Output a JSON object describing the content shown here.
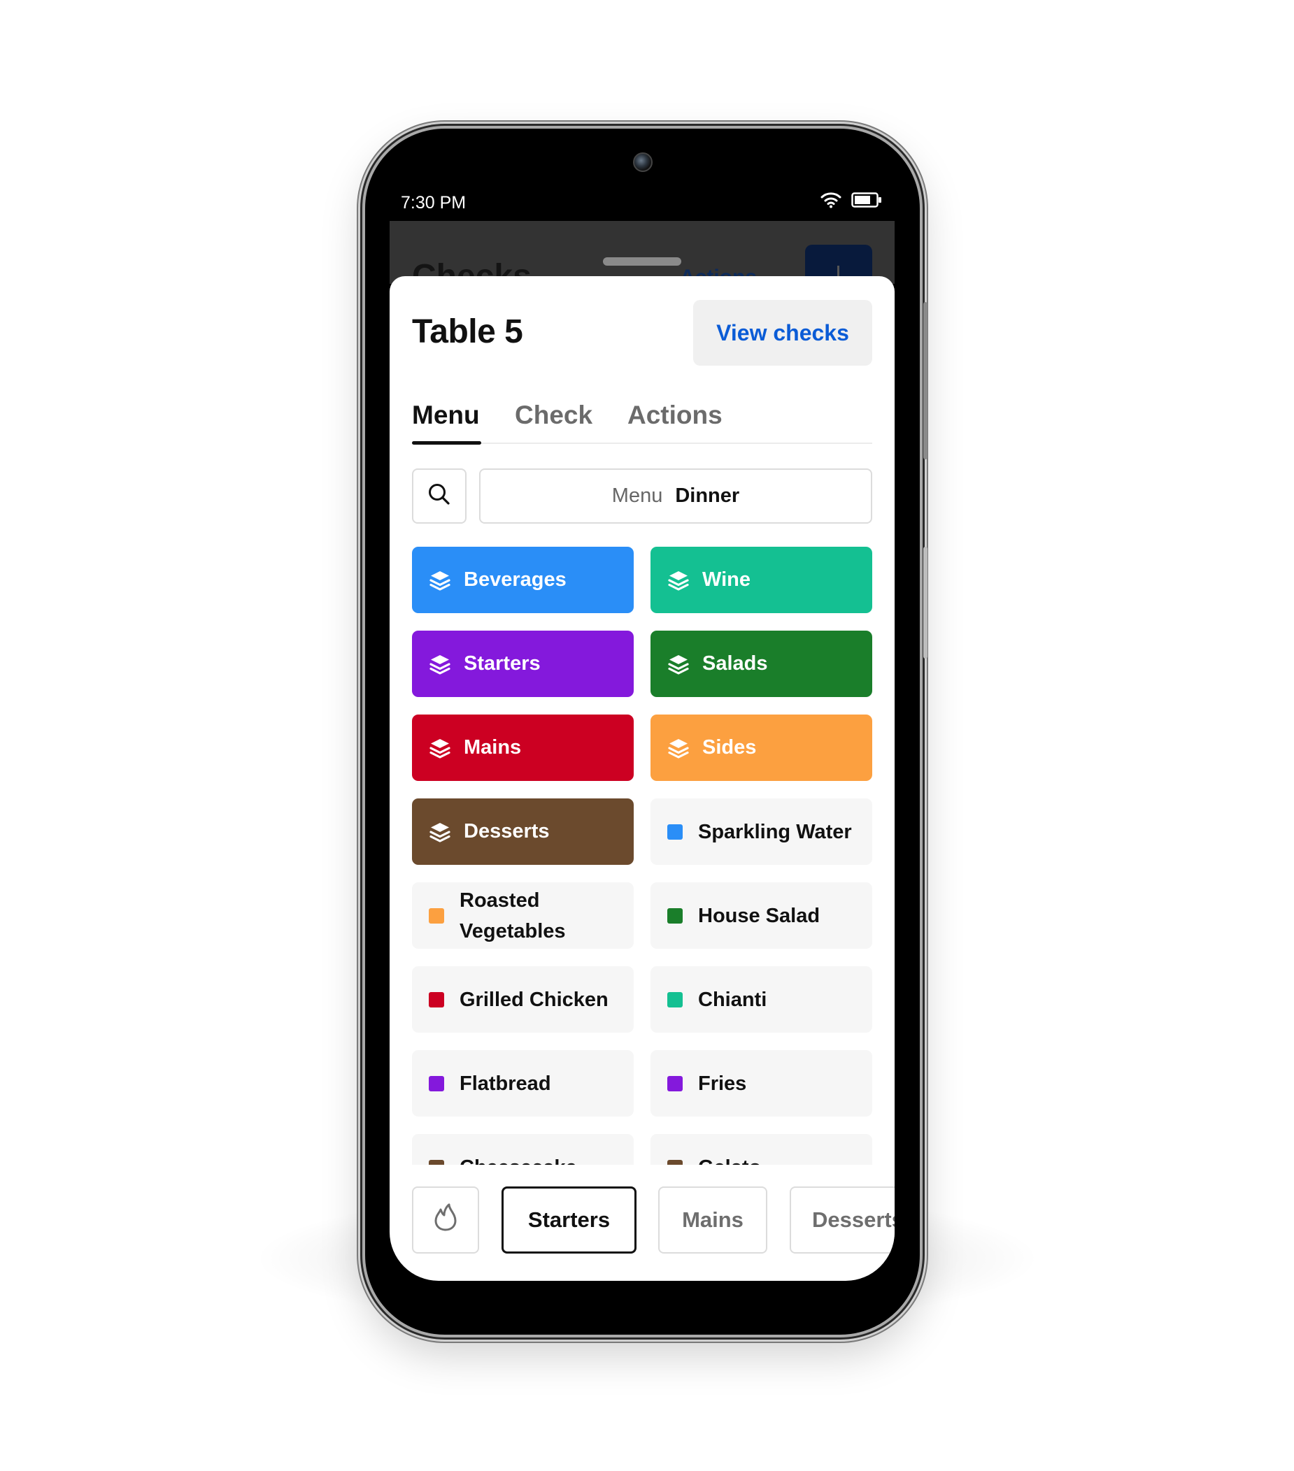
{
  "status_bar": {
    "time": "7:30 PM",
    "icons": [
      "wifi-icon",
      "battery-icon"
    ]
  },
  "background_screen": {
    "title": "Checks",
    "actions_label": "Actions"
  },
  "sheet": {
    "title": "Table 5",
    "view_checks_label": "View checks",
    "tabs": [
      {
        "label": "Menu",
        "active": true
      },
      {
        "label": "Check",
        "active": false
      },
      {
        "label": "Actions",
        "active": false
      }
    ],
    "search_icon": "search-icon",
    "menu_selector": {
      "label": "Menu",
      "value": "Dinner"
    }
  },
  "groups": [
    {
      "label": "Beverages",
      "color": "#2a8ef7"
    },
    {
      "label": "Wine",
      "color": "#14c092"
    },
    {
      "label": "Starters",
      "color": "#8419dc"
    },
    {
      "label": "Salads",
      "color": "#1a7e2a"
    },
    {
      "label": "Mains",
      "color": "#cc0022"
    },
    {
      "label": "Sides",
      "color": "#fca040"
    },
    {
      "label": "Desserts",
      "color": "#6b4a2d"
    }
  ],
  "items": [
    {
      "label": "Sparkling Water",
      "color": "#2a8ef7"
    },
    {
      "label": "Roasted Vegetables",
      "color": "#fca040"
    },
    {
      "label": "House Salad",
      "color": "#1a7e2a"
    },
    {
      "label": "Grilled Chicken",
      "color": "#cc0022"
    },
    {
      "label": "Chianti",
      "color": "#14c092"
    },
    {
      "label": "Flatbread",
      "color": "#8419dc"
    },
    {
      "label": "Fries",
      "color": "#8419dc"
    },
    {
      "label": "Cheesecake",
      "color": "#6b4a2d"
    },
    {
      "label": "Gelato",
      "color": "#6b4a2d"
    }
  ],
  "bottom_bar": {
    "flame_icon": "flame-icon",
    "chips": [
      {
        "label": "Starters",
        "selected": true
      },
      {
        "label": "Mains",
        "selected": false
      },
      {
        "label": "Desserts",
        "selected": false
      }
    ]
  }
}
